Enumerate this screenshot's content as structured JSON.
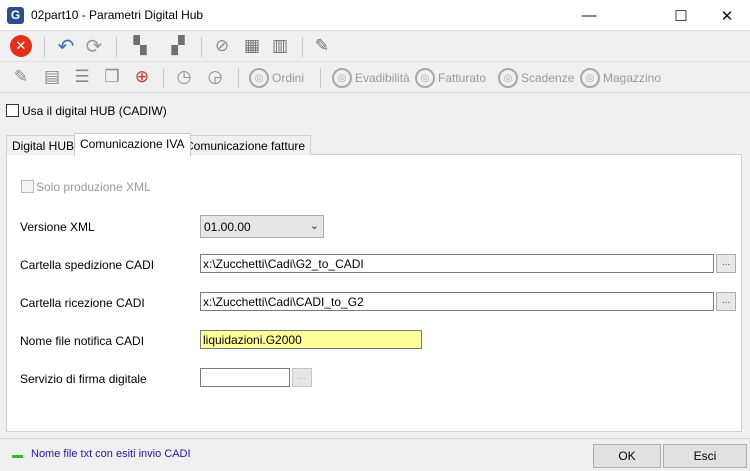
{
  "window": {
    "icon_letter": "G",
    "title": "02part10 - Parametri Digital Hub",
    "controls": {
      "minimize": "—",
      "maximize": "☐",
      "close": "✕"
    }
  },
  "toolbar1": {
    "icons": [
      "close-circle-icon",
      "undo-icon",
      "refresh-icon",
      "binoculars-icon",
      "binoculars-next-icon",
      "paperclip-icon",
      "copy-icon",
      "layout-icon",
      "note-icon"
    ],
    "glyphs": {
      "close": "✕",
      "undo": "↶",
      "refresh": "⟳",
      "binoculars": "▚",
      "binoculars_next": "▞",
      "paperclip": "⊘",
      "copy": "▦",
      "layout": "▥",
      "note": "✎"
    },
    "colors": {
      "close_bg": "#e0311f",
      "undo": "#3a6fbf",
      "active_icon": "#7a7a7a"
    }
  },
  "toolbar2": {
    "glyphs": {
      "pencil": "✎",
      "doc": "▤",
      "list": "☰",
      "copies": "❐",
      "search": "⊕",
      "clock_back": "◷",
      "clock_fwd": "◶"
    },
    "buttons": [
      {
        "label": "Ordini"
      },
      {
        "label": "Evadibilità"
      },
      {
        "label": "Fatturato"
      },
      {
        "label": "Scadenze"
      },
      {
        "label": "Magazzino"
      }
    ],
    "button_glyph": "◎"
  },
  "use_digital_hub": {
    "label": "Usa il digital HUB (CADIW)",
    "checked": false
  },
  "tabs": [
    {
      "label": "Digital HUB",
      "active": false
    },
    {
      "label": "Comunicazione IVA",
      "active": true
    },
    {
      "label": "Comunicazione fatture",
      "active": false
    }
  ],
  "form": {
    "solo_produzione": {
      "label": "Solo produzione XML",
      "checked": false,
      "enabled": false
    },
    "versione_xml": {
      "label": "Versione XML",
      "value": "01.00.00",
      "arrow": "⌄"
    },
    "cartella_spedizione": {
      "label": "Cartella spedizione CADI",
      "value": "x:\\Zucchetti\\Cadi\\G2_to_CADI",
      "button": "..."
    },
    "cartella_ricezione": {
      "label": "Cartella ricezione CADI",
      "value": "x:\\Zucchetti\\Cadi\\CADI_to_G2",
      "button": "..."
    },
    "nome_file_notifica": {
      "label": "Nome file notifica CADI",
      "value": "liquidazioni.G2000"
    },
    "servizio_firma": {
      "label": "Servizio di firma digitale",
      "value": "",
      "button": "..."
    }
  },
  "status": {
    "text": "Nome file txt con esiti invio CADI",
    "indicator_color": "#22c322"
  },
  "buttons": {
    "ok": "OK",
    "esci": "Esci"
  }
}
